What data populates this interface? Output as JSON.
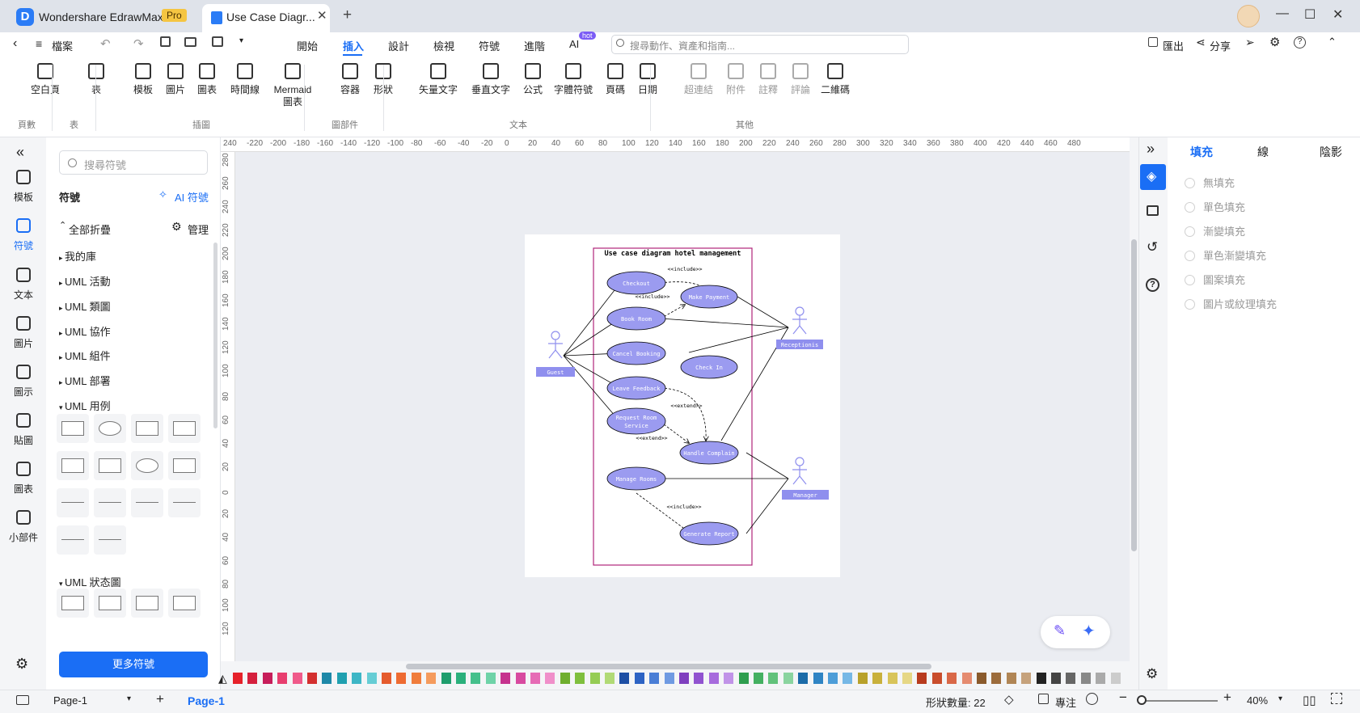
{
  "app": {
    "name": "Wondershare EdrawMax",
    "badge": "Pro",
    "tab_title": "Use Case Diagr...",
    "close": "✕",
    "new_tab": "+"
  },
  "window": {
    "minimize": "—",
    "maximize": "☐",
    "close": "✕"
  },
  "menu": {
    "file": "檔案",
    "items": [
      "開始",
      "插入",
      "設計",
      "檢視",
      "符號",
      "進階",
      "AI"
    ],
    "active": "插入",
    "hot_badge": "hot",
    "search_placeholder": "搜尋動作、資產和指南...",
    "export": "匯出",
    "share": "分享"
  },
  "ribbon": {
    "buttons": [
      {
        "label": "空白頁"
      },
      {
        "label": "表"
      },
      {
        "label": "模板"
      },
      {
        "label": "圖片"
      },
      {
        "label": "圖表"
      },
      {
        "label": "時間線"
      },
      {
        "label": "Mermaid\n圖表"
      },
      {
        "label": "容器"
      },
      {
        "label": "形狀"
      },
      {
        "label": "矢量文字"
      },
      {
        "label": "垂直文字"
      },
      {
        "label": "公式"
      },
      {
        "label": "字體符號"
      },
      {
        "label": "頁碼"
      },
      {
        "label": "日期"
      },
      {
        "label": "超連結"
      },
      {
        "label": "附件"
      },
      {
        "label": "註釋"
      },
      {
        "label": "評論"
      },
      {
        "label": "二維碼"
      }
    ],
    "groups": [
      "頁數",
      "表",
      "插圖",
      "圖部件",
      "文本",
      "其他"
    ]
  },
  "left_sidebar": [
    "模板",
    "符號",
    "文本",
    "圖片",
    "圖示",
    "貼圖",
    "圖表",
    "小部件"
  ],
  "symbols": {
    "search_placeholder": "搜尋符號",
    "heading": "符號",
    "ai": "AI 符號",
    "collapse_all": "全部折疊",
    "manage": "管理",
    "libraries": [
      "我的庫",
      "UML 活動",
      "UML 類圖",
      "UML 協作",
      "UML 組件",
      "UML 部署",
      "UML 用例",
      "UML 狀态圖"
    ],
    "more": "更多符號"
  },
  "ruler": {
    "top": [
      "240",
      "-220",
      "-200",
      "-180",
      "-160",
      "-140",
      "-120",
      "-100",
      "-80",
      "-60",
      "-40",
      "-20",
      "0",
      "20",
      "40",
      "60",
      "80",
      "100",
      "120",
      "140",
      "160",
      "180",
      "200",
      "220",
      "240",
      "260",
      "280",
      "300",
      "320",
      "340",
      "360",
      "380",
      "400",
      "420",
      "440",
      "460",
      "480"
    ],
    "left": [
      "280",
      "260",
      "240",
      "220",
      "200",
      "180",
      "160",
      "140",
      "120",
      "100",
      "80",
      "60",
      "40",
      "20",
      "0",
      "20",
      "40",
      "60",
      "80",
      "100",
      "120"
    ]
  },
  "diagram": {
    "title": "Use case diagram hotel management",
    "actors": [
      "Guest",
      "Receptionis",
      "Manager"
    ],
    "usecases": [
      "Checkout",
      "Make Payment",
      "Book Room",
      "Cancel Booking",
      "Check In",
      "Leave Feedback",
      "Request Room",
      "Service",
      "Handle Complain",
      "Manage Rooms",
      "Generate Report"
    ],
    "labels": [
      "<<include>>",
      "<<include>>",
      "<<extend>>",
      "<<extend>>",
      "<<include>>"
    ],
    "colors": {
      "usecase": "#9b9bf0",
      "boundary": "#b0247a",
      "actor": "#8f8fee"
    }
  },
  "right_panel": {
    "tabs": [
      "填充",
      "線",
      "陰影"
    ],
    "active_tab": "填充",
    "fill_options": [
      "無填充",
      "單色填充",
      "漸變填充",
      "單色漸變填充",
      "圖案填充",
      "圖片或紋理填充"
    ]
  },
  "status": {
    "page_selector": "Page-1",
    "active_page": "Page-1",
    "shape_count": "形狀數量: 22",
    "focus": "專注",
    "zoom": "40%"
  },
  "palette": [
    "#e6212a",
    "#d5203d",
    "#c71d5a",
    "#e83e6f",
    "#f05a8a",
    "#d32f2f",
    "#1e88a8",
    "#20a0b0",
    "#3eb6c6",
    "#66cdd5",
    "#e55b2d",
    "#ee6b32",
    "#f07d3c",
    "#f59b5d",
    "#1f9e6e",
    "#2bb07c",
    "#45c08c",
    "#6fd3a8",
    "#c6328e",
    "#d84aa0",
    "#e66bb5",
    "#f08fca",
    "#6fae2e",
    "#7fbf3e",
    "#95cc54",
    "#b1da76",
    "#1e4fa5",
    "#2d63c4",
    "#4a7ed6",
    "#6f9ae2",
    "#7f3fbf",
    "#9153d0",
    "#a76bdd",
    "#c193e8",
    "#2f9e4f",
    "#44b061",
    "#62c27b",
    "#8ad49f",
    "#1b6ba8",
    "#2f84c4",
    "#4d9dd8",
    "#76b8e6",
    "#b8a12b",
    "#c9b13c",
    "#d8c45a",
    "#e6d785",
    "#b83b1e",
    "#c94d2c",
    "#d96848",
    "#e58b70",
    "#8a5a2c",
    "#9c6c3c",
    "#b08555",
    "#c6a27c",
    "#222222",
    "#444444",
    "#666666",
    "#888888",
    "#aaaaaa",
    "#cccccc"
  ]
}
